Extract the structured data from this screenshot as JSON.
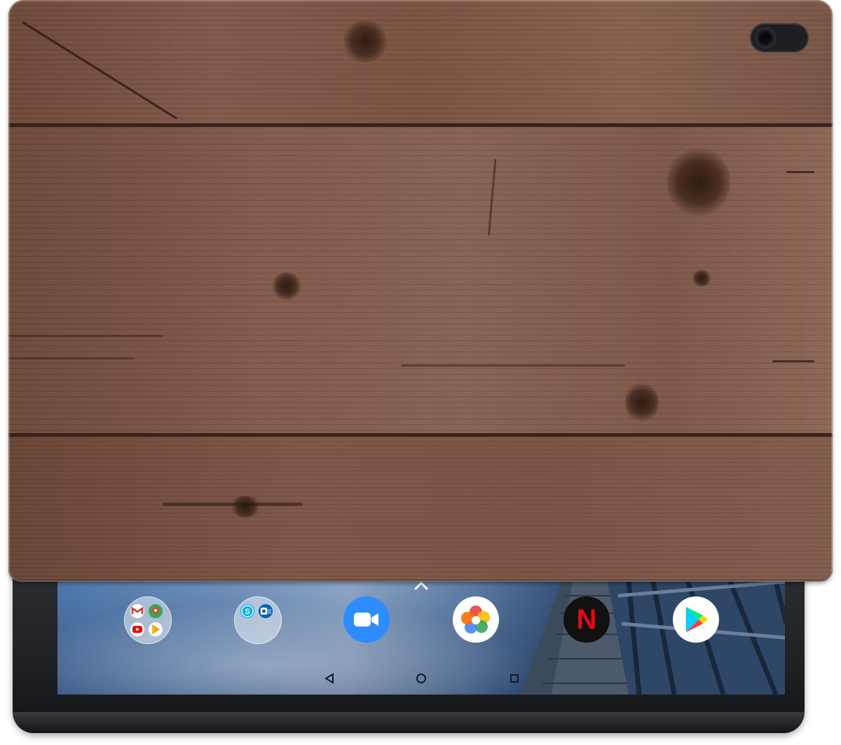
{
  "device": {
    "case_pattern": "wood-planks",
    "case_color": "#7a5242",
    "bezel_color": "#1f2023"
  },
  "dock": {
    "items": [
      {
        "name": "google-apps-folder",
        "icon": "folder-icon"
      },
      {
        "name": "skype-outlook-folder",
        "icon": "folder-icon"
      },
      {
        "name": "zoom-app",
        "icon": "video-camera-icon",
        "color": "#2d8cff"
      },
      {
        "name": "photos-app",
        "icon": "pinwheel-icon"
      },
      {
        "name": "netflix-app",
        "icon": "netflix-icon",
        "color": "#e50914"
      },
      {
        "name": "play-store-app",
        "icon": "play-store-icon"
      }
    ],
    "netflix_letter": "N"
  },
  "navbar": {
    "back": "back-icon",
    "home": "home-icon",
    "recents": "recents-icon"
  }
}
